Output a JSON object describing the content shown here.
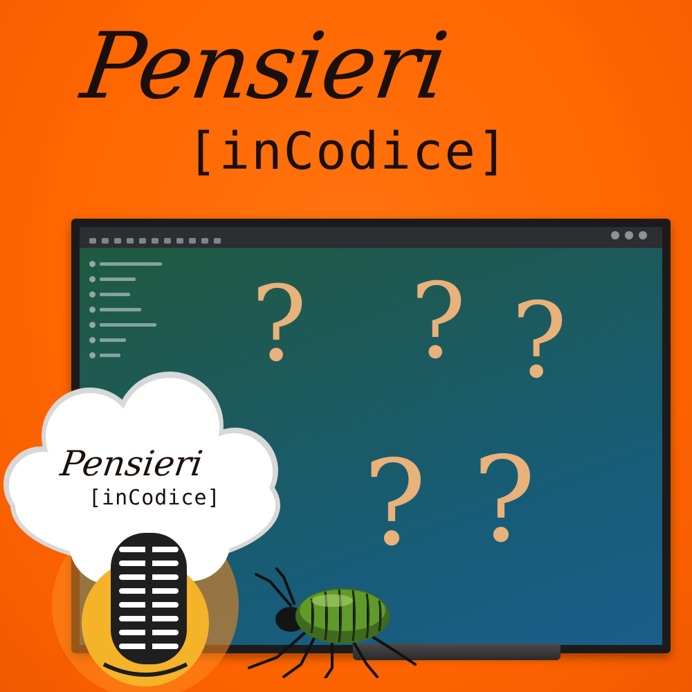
{
  "title": {
    "script": "Pensieri",
    "mono": "[inCodice]"
  },
  "monitor_screen": {
    "question_marks": [
      "?",
      "?",
      "?",
      "?",
      "?"
    ],
    "accent_color": "#e8b27a"
  },
  "logo": {
    "script": "Pensieri",
    "mono": "[inCodice]",
    "microphone_icon": "microphone-icon",
    "circle_color": "#f5b32a"
  },
  "colors": {
    "background": "#ff6a00",
    "text": "#1a0f0a",
    "screen_gradient": [
      "#1f5a3c",
      "#1a5f8a"
    ]
  }
}
